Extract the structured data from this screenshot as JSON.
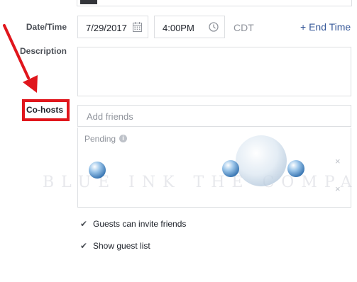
{
  "form": {
    "datetime_label": "Date/Time",
    "date_value": "7/29/2017",
    "time_value": "4:00PM",
    "timezone": "CDT",
    "end_time_link": "+ End Time",
    "description_label": "Description",
    "cohosts_label": "Co-hosts",
    "cohosts_placeholder": "Add friends",
    "pending_label": "Pending",
    "remove_glyph": "×",
    "check_glyph": "✔",
    "options": [
      {
        "label": "Guests can invite friends",
        "checked": true
      },
      {
        "label": "Show guest list",
        "checked": true
      }
    ]
  },
  "annotation": {
    "arrow_color": "#e0161c",
    "highlight_color": "#e0161c"
  },
  "watermark": {
    "text": "BLUE INK THE COMPANY"
  }
}
